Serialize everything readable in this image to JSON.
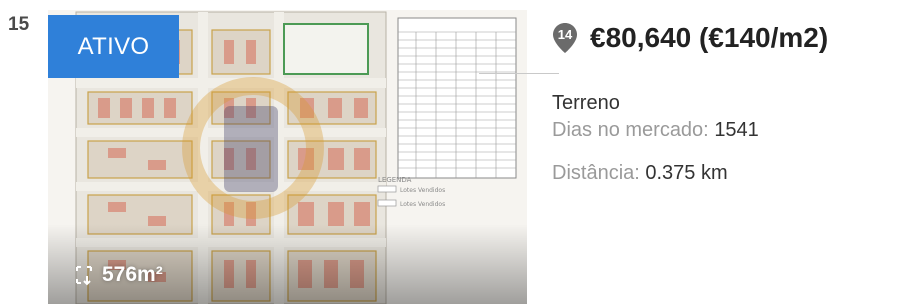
{
  "listing": {
    "index": "15",
    "status": "ATIVO",
    "area": "576m²",
    "marker_number": "14",
    "price": "€80,640 (€140/m2)",
    "type": "Terreno",
    "days_label": "Dias no mercado:",
    "days_value": "1541",
    "distance_label": "Distância:",
    "distance_value": "0.375 km"
  },
  "plan_legend": {
    "title": "LEGENDA",
    "items": [
      "Lotes Vendidos",
      "Lotes Vendidos"
    ]
  },
  "colors": {
    "badge": "#2f80d9",
    "marker": "#6b6b6b"
  }
}
